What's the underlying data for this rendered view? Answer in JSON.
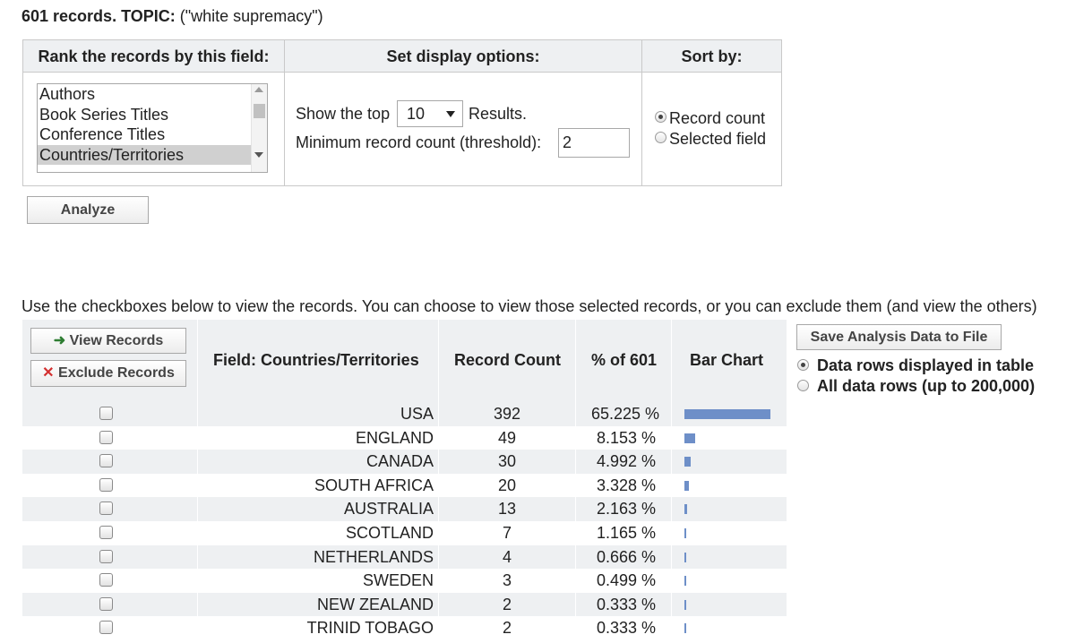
{
  "header": {
    "count_topic": "601 records. TOPIC:",
    "query": "(\"white supremacy\")"
  },
  "options": {
    "rank_header": "Rank the records by this field:",
    "display_header": "Set display options:",
    "sort_header": "Sort by:",
    "field_list": [
      "Authors",
      "Book Series Titles",
      "Conference Titles",
      "Countries/Territories"
    ],
    "field_selected": "Countries/Territories",
    "show_top_prefix": "Show the top",
    "show_top_value": "10",
    "show_top_suffix": "Results.",
    "min_count_label": "Minimum record count (threshold):",
    "min_count_value": "2",
    "sort_record_count": "Record count",
    "sort_selected_field": "Selected field"
  },
  "analyze_button": "Analyze",
  "note": "Use the checkboxes below to view the records. You can choose to view those selected records, or you can exclude them (and view the others)",
  "results": {
    "view_records": "View Records",
    "exclude_records": "Exclude Records",
    "col_field": "Field: Countries/Territories",
    "col_count": "Record Count",
    "col_pct": "% of 601",
    "col_bar": "Bar Chart",
    "save_button": "Save Analysis Data to File",
    "opt_displayed": "Data rows displayed in table",
    "opt_all": "All data rows (up to 200,000)",
    "rows": [
      {
        "name": "USA",
        "count": "392",
        "pct": "65.225 %",
        "share": 0.65225
      },
      {
        "name": "ENGLAND",
        "count": "49",
        "pct": "8.153 %",
        "share": 0.08153
      },
      {
        "name": "CANADA",
        "count": "30",
        "pct": "4.992 %",
        "share": 0.04992
      },
      {
        "name": "SOUTH AFRICA",
        "count": "20",
        "pct": "3.328 %",
        "share": 0.03328
      },
      {
        "name": "AUSTRALIA",
        "count": "13",
        "pct": "2.163 %",
        "share": 0.02163
      },
      {
        "name": "SCOTLAND",
        "count": "7",
        "pct": "1.165 %",
        "share": 0.01165
      },
      {
        "name": "NETHERLANDS",
        "count": "4",
        "pct": "0.666 %",
        "share": 0.00666
      },
      {
        "name": "SWEDEN",
        "count": "3",
        "pct": "0.499 %",
        "share": 0.00499
      },
      {
        "name": "NEW ZEALAND",
        "count": "2",
        "pct": "0.333 %",
        "share": 0.00333
      },
      {
        "name": "TRINID TOBAGO",
        "count": "2",
        "pct": "0.333 %",
        "share": 0.00333
      }
    ]
  },
  "colors": {
    "bar": "#6e8fc8",
    "header_bg": "#eef0f2",
    "view_arrow": "#2e7d32",
    "exclude_x": "#d32f2f"
  },
  "icons": {
    "view": "right-arrow-icon",
    "exclude": "x-icon"
  }
}
